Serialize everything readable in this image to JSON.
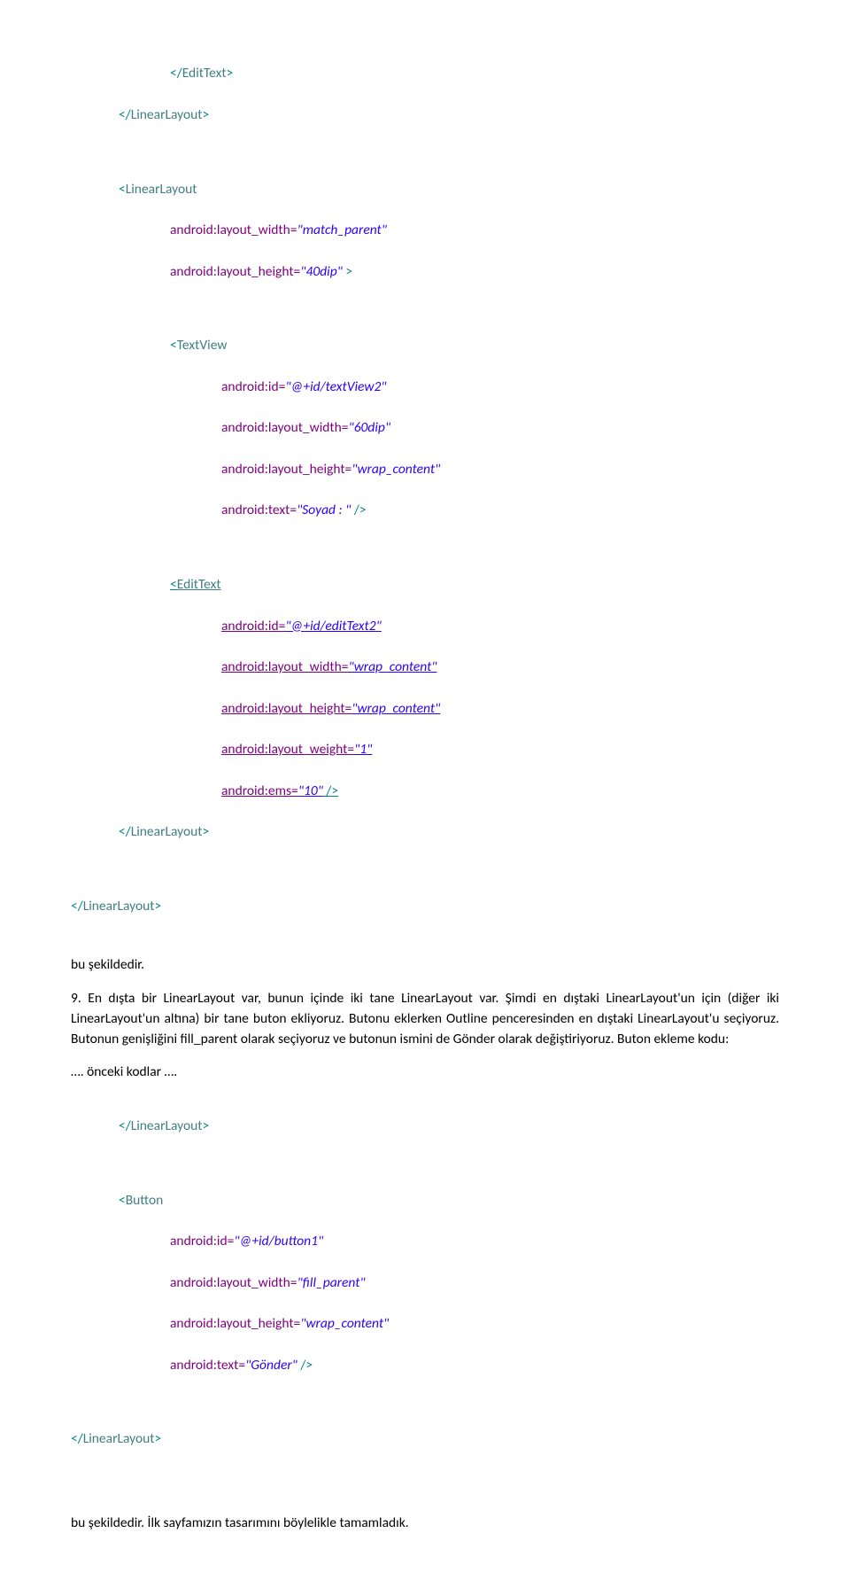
{
  "code1": {
    "l1": "</EditText>",
    "l2": "</LinearLayout>",
    "l3": "<LinearLayout",
    "l4a": "android:layout_width=",
    "l4v": "\"match_parent\"",
    "l5a": "android:layout_height=",
    "l5v": "\"40dip\"",
    "l5e": " >",
    "l6": "<TextView",
    "l7a": "android:id=",
    "l7v": "\"@+id/textView2\"",
    "l8a": "android:layout_width=",
    "l8v": "\"60dip\"",
    "l9a": "android:layout_height=",
    "l9v": "\"wrap_content\"",
    "l10a": "android:text=",
    "l10v": "\"Soyad : \"",
    "l10e": " />",
    "l11": "<EditText",
    "l12a": "android:id=",
    "l12v": "\"@+id/editText2\"",
    "l13a": "android:layout_width=",
    "l13v": "\"wrap_content\"",
    "l14a": "android:layout_height=",
    "l14v": "\"wrap_content\"",
    "l15a": "android:layout_weight=",
    "l15v": "\"1\"",
    "l16a": "android:ems=",
    "l16v": "\"10\"",
    "l16e": " />",
    "l17": "</LinearLayout>",
    "l18": "</LinearLayout>"
  },
  "para1": "bu şekildedir.",
  "para2": "9. En dışta bir LinearLayout var, bunun içinde iki tane LinearLayout var. Şimdi en dıştaki LinearLayout'un için (diğer iki LinearLayout'un altına) bir tane buton ekliyoruz. Butonu eklerken Outline penceresinden en dıştaki LinearLayout'u seçiyoruz. Butonun genişliğini fill_parent olarak seçiyoruz ve butonun ismini de Gönder olarak değiştiriyoruz. Buton ekleme kodu:",
  "para3": "…. önceki kodlar ….",
  "code2": {
    "l1": "</LinearLayout>",
    "l2": "<Button",
    "l3a": "android:id=",
    "l3v": "\"@+id/button1\"",
    "l4a": "android:layout_width=",
    "l4v": "\"fill_parent\"",
    "l5a": "android:layout_height=",
    "l5v": "\"wrap_content\"",
    "l6a": "android:text=",
    "l6v": "\"Gönder\"",
    "l6e": " />",
    "l7": "</LinearLayout>"
  },
  "para4": "bu şekildedir. İlk sayfamızın tasarımını böylelikle tamamladık."
}
